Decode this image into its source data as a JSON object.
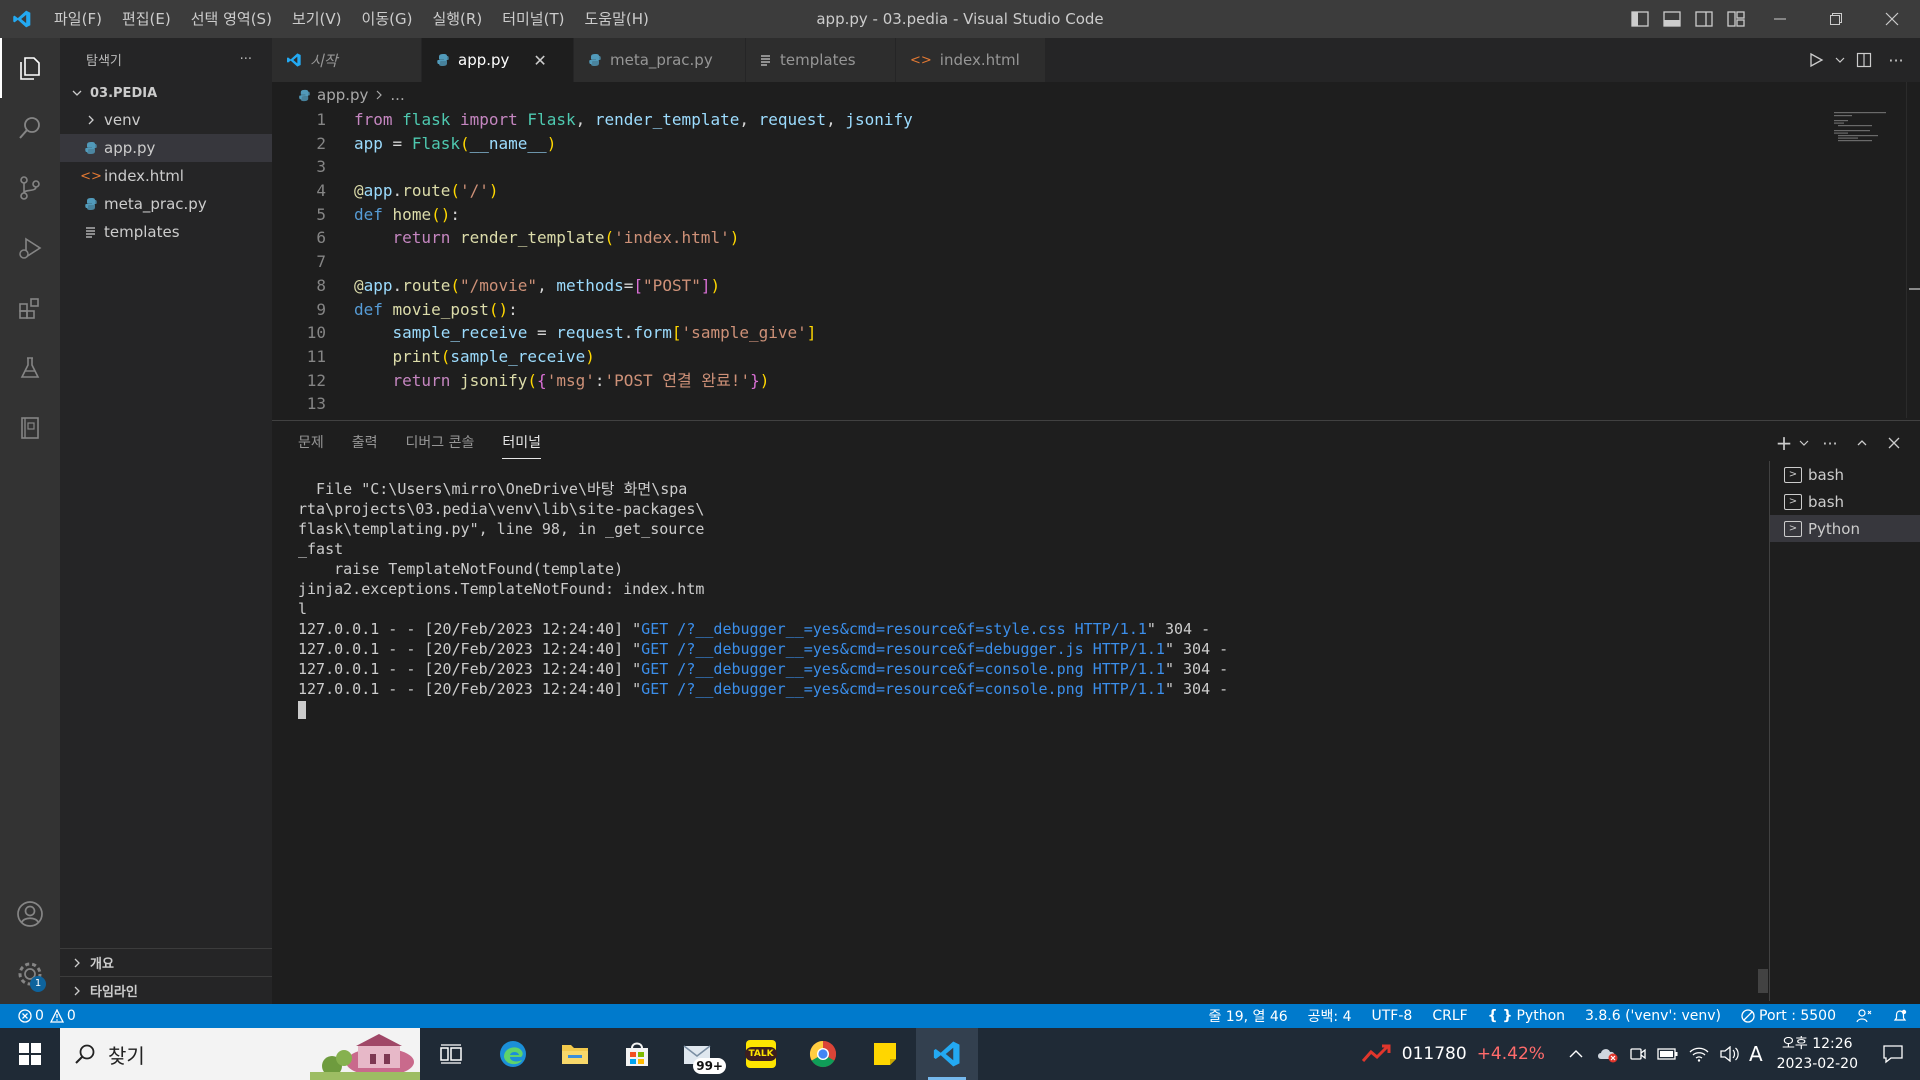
{
  "titlebar": {
    "menu": [
      "파일(F)",
      "편집(E)",
      "선택 영역(S)",
      "보기(V)",
      "이동(G)",
      "실행(R)",
      "터미널(T)",
      "도움말(H)"
    ],
    "title": "app.py - 03.pedia - Visual Studio Code"
  },
  "sidebar": {
    "header": "탐색기",
    "more": "···",
    "section": "03.PEDIA",
    "items": [
      {
        "label": "venv",
        "icon": "chevron-right-icon"
      },
      {
        "label": "app.py",
        "icon": "python-file-icon"
      },
      {
        "label": "index.html",
        "icon": "html-file-icon"
      },
      {
        "label": "meta_prac.py",
        "icon": "python-file-icon"
      },
      {
        "label": "templates",
        "icon": "lines-file-icon"
      }
    ],
    "bottom": [
      "개요",
      "타임라인"
    ]
  },
  "activitybar": {
    "settings_badge": "1"
  },
  "tabs": [
    {
      "label": "시작",
      "icon": "vscode-icon",
      "active": false
    },
    {
      "label": "app.py",
      "icon": "python-file-icon",
      "active": true
    },
    {
      "label": "meta_prac.py",
      "icon": "python-file-icon",
      "active": false
    },
    {
      "label": "templates",
      "icon": "lines-file-icon",
      "active": false
    },
    {
      "label": "index.html",
      "icon": "html-file-icon",
      "active": false
    }
  ],
  "breadcrumb": {
    "file": "app.py",
    "rest": "..."
  },
  "editor": {
    "line_numbers": [
      "1",
      "2",
      "3",
      "4",
      "5",
      "6",
      "7",
      "8",
      "9",
      "10",
      "11",
      "12",
      "13"
    ],
    "lines": [
      "from flask import Flask, render_template, request, jsonify",
      "app = Flask(__name__)",
      "",
      "@app.route('/')",
      "def home():",
      "    return render_template('index.html')",
      "",
      "@app.route(\"/movie\", methods=[\"POST\"])",
      "def movie_post():",
      "    sample_receive = request.form['sample_give']",
      "    print(sample_receive)",
      "    return jsonify({'msg':'POST 연결 완료!'})",
      ""
    ]
  },
  "panel": {
    "tabs": [
      "문제",
      "출력",
      "디버그 콘솔",
      "터미널"
    ],
    "active_tab": "터미널",
    "terminal_lines": [
      "  File \"C:\\Users\\mirro\\OneDrive\\바탕 화면\\spa",
      "rta\\projects\\03.pedia\\venv\\lib\\site-packages\\",
      "flask\\templating.py\", line 98, in _get_source",
      "_fast",
      "    raise TemplateNotFound(template)",
      "jinja2.exceptions.TemplateNotFound: index.htm",
      "l"
    ],
    "log_lines": [
      {
        "prefix": "127.0.0.1 - - [20/Feb/2023 12:24:40] \"",
        "request": "GET /?__debugger__=yes&cmd=resource&f=style.css HTTP/1.1",
        "suffix": "\" 304 -"
      },
      {
        "prefix": "127.0.0.1 - - [20/Feb/2023 12:24:40] \"",
        "request": "GET /?__debugger__=yes&cmd=resource&f=debugger.js HTTP/1.1",
        "suffix": "\" 304 -"
      },
      {
        "prefix": "127.0.0.1 - - [20/Feb/2023 12:24:40] \"",
        "request": "GET /?__debugger__=yes&cmd=resource&f=console.png HTTP/1.1",
        "suffix": "\" 304 -"
      },
      {
        "prefix": "127.0.0.1 - - [20/Feb/2023 12:24:40] \"",
        "request": "GET /?__debugger__=yes&cmd=resource&f=console.png HTTP/1.1",
        "suffix": "\" 304 -"
      }
    ],
    "terminals": [
      "bash",
      "bash",
      "Python"
    ],
    "active_terminal": "Python"
  },
  "statusbar": {
    "errors": "0",
    "warnings": "0",
    "position": "줄 19, 열 46",
    "spaces": "공백: 4",
    "encoding": "UTF-8",
    "eol": "CRLF",
    "language": "Python",
    "interpreter": "3.8.6 ('venv': venv)",
    "port": "Port : 5500"
  },
  "taskbar": {
    "search": "찾기",
    "mail_badge": "99+",
    "kakao_label": "TALK",
    "stock_code": "011780",
    "stock_change": "+4.42%",
    "ime": "A",
    "time": "오후 12:26",
    "date": "2023-02-20"
  },
  "colors": {
    "accent": "#007acc",
    "titlebar": "#3c3c3c",
    "editor_bg": "#1e1e1e",
    "sidebar_bg": "#252526",
    "activitybar_bg": "#333333",
    "stock_up": "#ff6b6b"
  }
}
